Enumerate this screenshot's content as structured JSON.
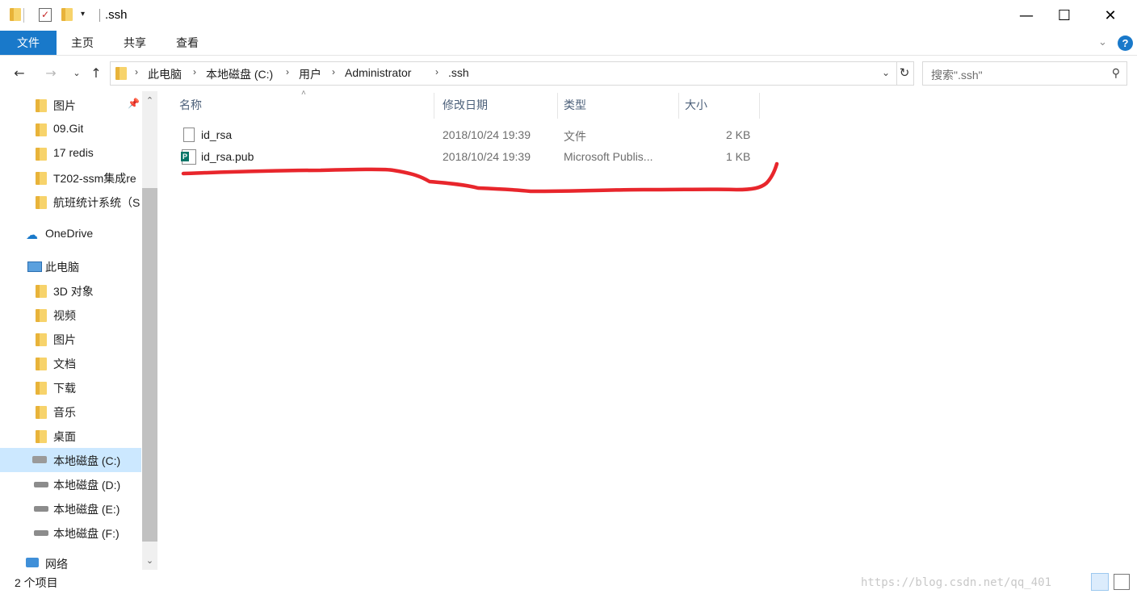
{
  "window": {
    "title": ".ssh",
    "minimize": "—",
    "maximize": "☐",
    "close": "✕",
    "colors": {
      "accent": "#1979ca",
      "selected": "#cce8ff"
    }
  },
  "ribbon": {
    "tabs": [
      "文件",
      "主页",
      "共享",
      "查看"
    ],
    "help": "?"
  },
  "address": {
    "crumbs": [
      "此电脑",
      "本地磁盘 (C:)",
      "用户",
      "Administrator",
      ".ssh"
    ],
    "search_placeholder": "搜索\".ssh\""
  },
  "sidebar": {
    "quick_access": [
      "图片",
      "09.Git",
      "17 redis",
      "T202-ssm集成re",
      "航班统计系统（S"
    ],
    "onedrive": "OneDrive",
    "this_pc": "此电脑",
    "pc_items": [
      "3D 对象",
      "视频",
      "图片",
      "文档",
      "下载",
      "音乐",
      "桌面"
    ],
    "drives": [
      "本地磁盘 (C:)",
      "本地磁盘 (D:)",
      "本地磁盘 (E:)",
      "本地磁盘 (F:)"
    ],
    "network": "网络"
  },
  "columns": [
    "名称",
    "修改日期",
    "类型",
    "大小"
  ],
  "files": [
    {
      "name": "id_rsa",
      "date": "2018/10/24 19:39",
      "type": "文件",
      "size": "2 KB",
      "icon": "file-icon"
    },
    {
      "name": "id_rsa.pub",
      "date": "2018/10/24 19:39",
      "type": "Microsoft Publis...",
      "size": "1 KB",
      "icon": "publisher-icon"
    }
  ],
  "status": {
    "item_count": "2 个项目",
    "watermark": "https://blog.csdn.net/qq_401"
  },
  "annotation": {
    "color": "#e8262c"
  }
}
